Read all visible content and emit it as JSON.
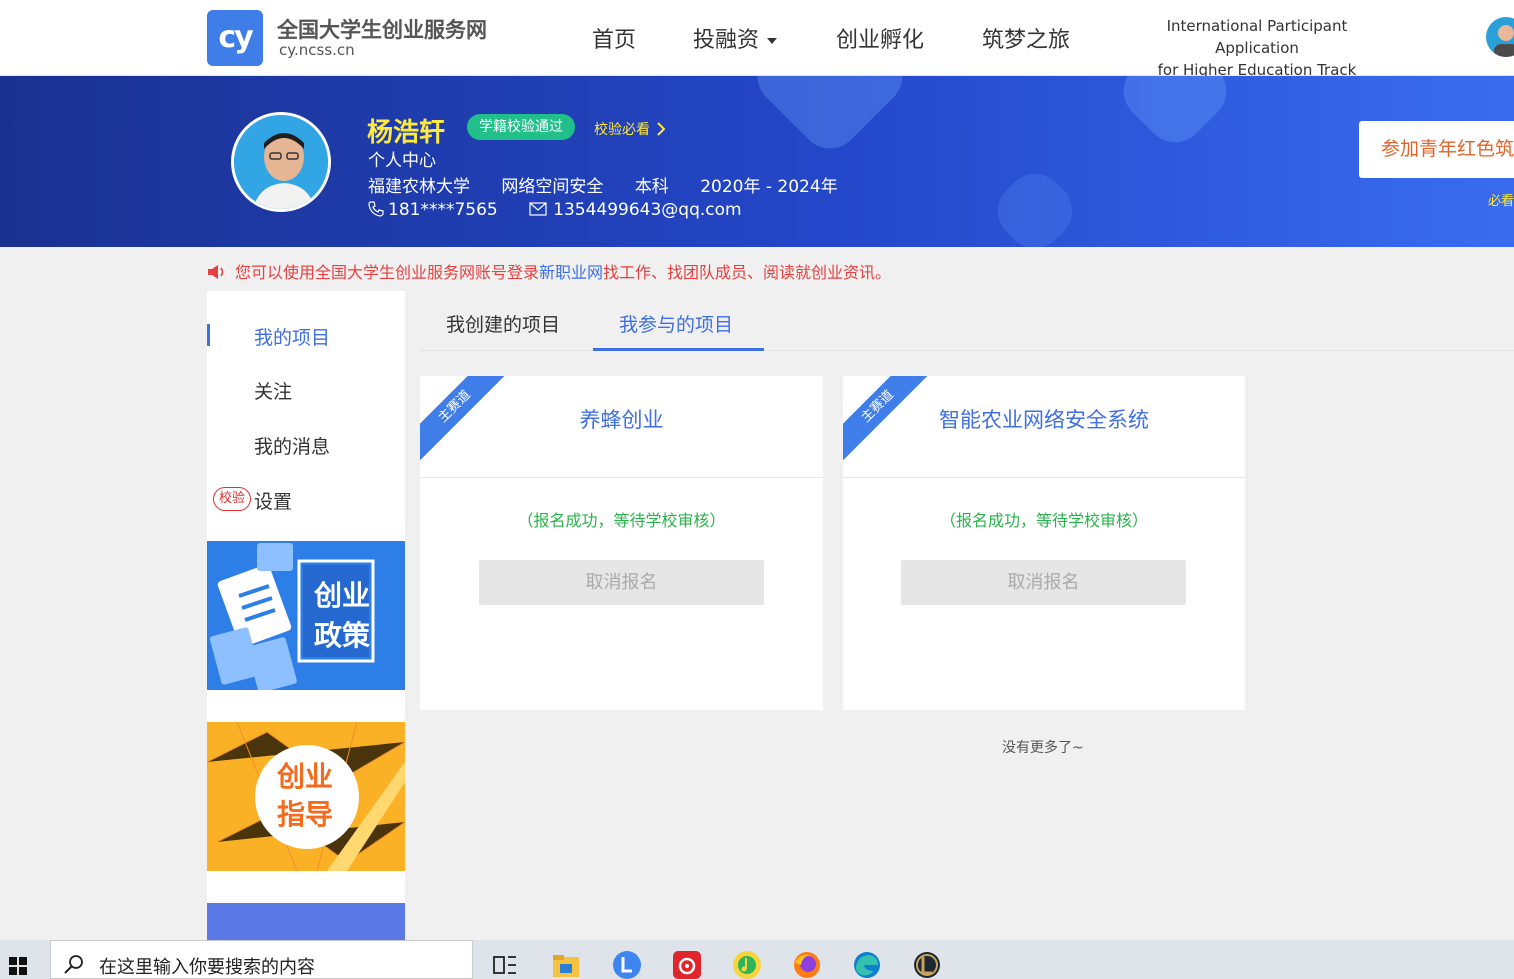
{
  "header": {
    "logo_mark": "cy",
    "site_name": "全国大学生创业服务网",
    "site_domain": "cy.ncss.cn",
    "nav": [
      "首页",
      "投融资",
      "创业孵化",
      "筑梦之旅"
    ],
    "intl_line1": "International Participant Application",
    "intl_line2": "for Higher Education Track"
  },
  "profile": {
    "name": "杨浩轩",
    "verified_badge": "学籍校验通过",
    "verify_link": "校验必看",
    "center_label": "个人中心",
    "university": "福建农林大学",
    "major": "网络空间安全",
    "degree": "本科",
    "years": "2020年 - 2024年",
    "phone": "181****7565",
    "email": "1354499643@qq.com",
    "join_button": "参加青年红色筑",
    "must_see": "必看"
  },
  "notice": {
    "prefix": "您可以使用全国大学生创业服务网账号登录",
    "link": "新职业网",
    "suffix": "找工作、找团队成员、阅读就创业资讯。"
  },
  "sidebar": {
    "items": [
      "我的项目",
      "关注",
      "我的消息",
      "设置"
    ],
    "verify_badge": "校验",
    "promo1_line1": "创业",
    "promo1_line2": "政策",
    "promo2_line1": "创业",
    "promo2_line2": "指导"
  },
  "tabs": [
    "我创建的项目",
    "我参与的项目"
  ],
  "projects": [
    {
      "ribbon": "主赛道",
      "title": "养蜂创业",
      "status": "（报名成功，等待学校审核）",
      "action": "取消报名"
    },
    {
      "ribbon": "主赛道",
      "title": "智能农业网络安全系统",
      "status": "（报名成功，等待学校审核）",
      "action": "取消报名"
    }
  ],
  "no_more": "没有更多了~",
  "taskbar": {
    "search_placeholder": "在这里输入你要搜索的内容"
  },
  "colors": {
    "accent": "#3f6fe0",
    "banner_dark": "#1a3190",
    "name_yellow": "#ffe93a",
    "badge_green": "#21c08a",
    "status_green": "#2bb24c",
    "notice_red": "#e64040"
  }
}
